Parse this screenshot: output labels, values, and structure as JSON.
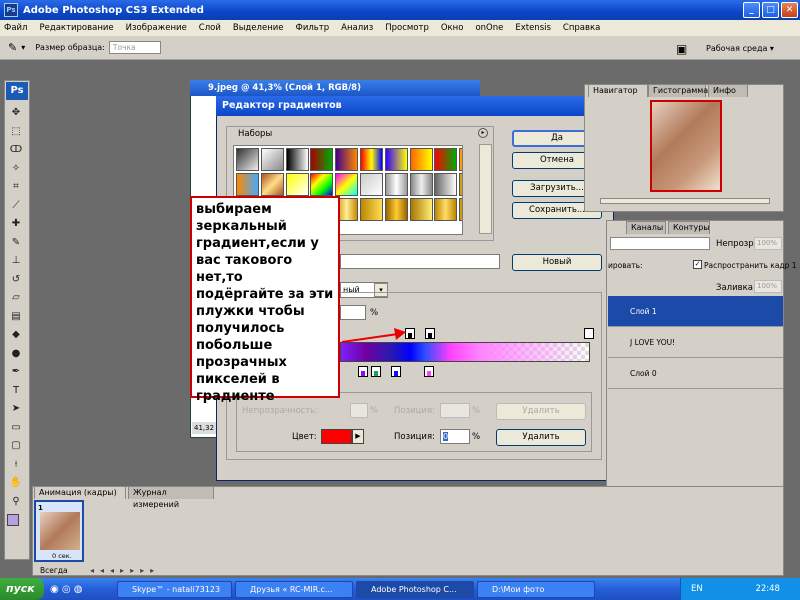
{
  "app": {
    "title": "Adobe Photoshop CS3 Extended",
    "menu": [
      "Файл",
      "Редактирование",
      "Изображение",
      "Слой",
      "Выделение",
      "Фильтр",
      "Анализ",
      "Просмотр",
      "Окно",
      "onOne",
      "Extensis",
      "Справка"
    ],
    "options": {
      "sample_size_label": "Размер образца:",
      "sample_size_value": "Точка",
      "workspace_label": "Рабочая среда ▾"
    }
  },
  "document": {
    "title": "9.jpeg @ 41,3% (Слой 1, RGB/8)",
    "zoom": "41,32"
  },
  "dialog": {
    "title": "Редактор градиентов",
    "presets_label": "Наборы",
    "buttons": {
      "ok": "Да",
      "cancel": "Отмена",
      "load": "Загрузить...",
      "save": "Сохранить...",
      "new": "Новый",
      "delete_opacity": "Удалить",
      "delete_color": "Удалить"
    },
    "type_value": "ный",
    "smoothness_unit": "%",
    "stops_group": {
      "opacity_label": "Непрозрачность:",
      "opacity_unit": "%",
      "location_label_1": "Позиция:",
      "location_unit_1": "%",
      "color_label": "Цвет:",
      "color_value": "#ff0000",
      "location_label_2": "Позиция:",
      "location_unit_2": "%",
      "location_value": "0"
    }
  },
  "callout": {
    "text": "выбираем зеркальный градиент,если у вас такового нет,то подёргайте за эти плужки чтобы получилось побольше прозрачных пикселей  в градиенте"
  },
  "panels": {
    "nav_tabs": [
      "Навигатор",
      "Гистограмма",
      "Инфо"
    ],
    "layer_tabs": [
      "Каналы",
      "Контуры"
    ],
    "opacity_label": "Непрозр:",
    "opacity_value": "100%",
    "lock_label": "ировать:",
    "propagate_label": "Распространить кадр 1",
    "fill_label": "Заливка:",
    "fill_value": "100%",
    "layers": [
      {
        "name": "Слой 1"
      },
      {
        "name": "J LOVE YOU!"
      },
      {
        "name": "Слой 0"
      }
    ]
  },
  "animation": {
    "tabs": [
      "Анимация (кадры)",
      "Журнал измерений"
    ],
    "frame_number": "1",
    "frame_delay": "0 сек.",
    "loop": "Всегда"
  },
  "taskbar": {
    "start": "пуск",
    "items": [
      "Skype™ - natali73123",
      "Друзья « RC-MIR.c...",
      "Adobe Photoshop C...",
      "D:\\Мои фото"
    ],
    "lang": "EN",
    "time": "22:48"
  }
}
